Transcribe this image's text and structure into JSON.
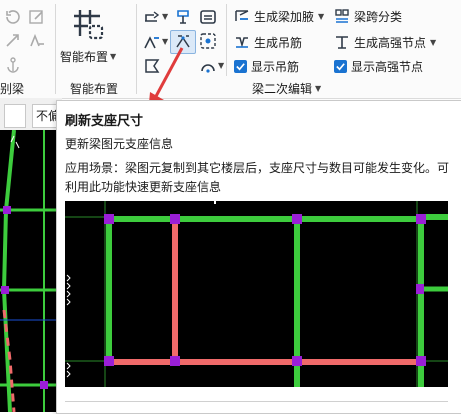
{
  "ribbon": {
    "smart_layout": {
      "label": "智能布置",
      "group_label": "智能布置"
    },
    "left_group_label": "别梁",
    "beam_edit_group": {
      "label": "梁二次编辑",
      "gen_haunch": "生成梁加腋",
      "gen_hanger": "生成吊筋",
      "show_hanger": "显示吊筋",
      "span_classify": "梁跨分类",
      "gen_high_strength_joint": "生成高强节点",
      "show_high_strength_joint": "显示高强节点"
    }
  },
  "left_strip": {
    "dropdown_value": "不偏"
  },
  "tooltip": {
    "title": "刷新支座尺寸",
    "subtitle": "更新梁图元支座信息",
    "description": "应用场景：梁图元复制到其它楼层后，支座尺寸与数目可能发生变化。可利用此功能快速更新支座信息"
  },
  "colors": {
    "accent_blue": "#1a73d1",
    "arrow_red": "#e03c3c",
    "beam_green": "#3dcc3d",
    "beam_red": "#f06a6a",
    "support_purple": "#9a1fd6"
  }
}
